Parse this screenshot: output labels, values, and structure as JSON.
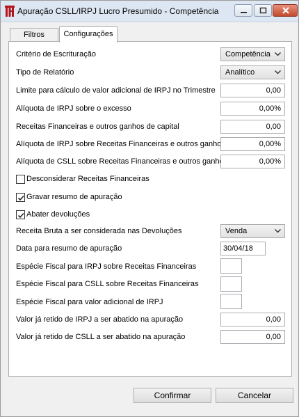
{
  "window": {
    "title": "Apuração CSLL/IRPJ Lucro Presumido - Competência"
  },
  "tabs": [
    {
      "label": "Filtros"
    },
    {
      "label": "Configurações"
    }
  ],
  "form": {
    "criterio_label": "Critério de Escrituração",
    "criterio_value": "Competência",
    "tipo_label": "Tipo de Relatório",
    "tipo_value": "Analítico",
    "limite_label": "Limite para cálculo de valor adicional de IRPJ no Trimestre",
    "limite_value": "0,00",
    "aliq_irpj_label": "Alíquota de IRPJ sobre o excesso",
    "aliq_irpj_value": "0,00%",
    "receitas_label": "Receitas Financeiras e outros ganhos de capital",
    "receitas_value": "0,00",
    "aliq_irpj_rf_label": "Alíquota de IRPJ sobre Receitas Financeiras e outros ganhos",
    "aliq_irpj_rf_value": "0,00%",
    "aliq_csll_rf_label": "Alíquota de CSLL sobre Receitas Financeiras e outros ganhos",
    "aliq_csll_rf_value": "0,00%",
    "desconsiderar_label": "Desconsiderar Receitas Financeiras",
    "desconsiderar_checked": false,
    "gravar_label": "Gravar resumo de apuração",
    "gravar_checked": true,
    "abater_label": "Abater devoluções",
    "abater_checked": true,
    "receita_bruta_label": "Receita Bruta a ser considerada nas Devoluções",
    "receita_bruta_value": "Venda",
    "data_label": "Data para resumo de apuração",
    "data_value": "30/04/18",
    "especie_irpj_label": "Espécie Fiscal para IRPJ sobre Receitas Financeiras",
    "especie_csll_label": "Espécie Fiscal para CSLL sobre Receitas Financeiras",
    "especie_adic_label": "Espécie Fiscal para valor adicional de IRPJ",
    "retido_irpj_label": "Valor já retido de IRPJ a ser abatido na apuração",
    "retido_irpj_value": "0,00",
    "retido_csll_label": "Valor já retido de CSLL a ser abatido na apuração",
    "retido_csll_value": "0,00"
  },
  "buttons": {
    "confirm": "Confirmar",
    "cancel": "Cancelar"
  },
  "colors": {
    "titlebar": "#dde7f3",
    "close": "#c44a2f",
    "logo": "#b3151b"
  },
  "icons": {
    "app": "app-logo-icon",
    "minimize": "minimize-icon",
    "maximize": "maximize-icon",
    "close": "close-icon",
    "dropdown": "chevron-down-icon",
    "check": "check-icon"
  }
}
